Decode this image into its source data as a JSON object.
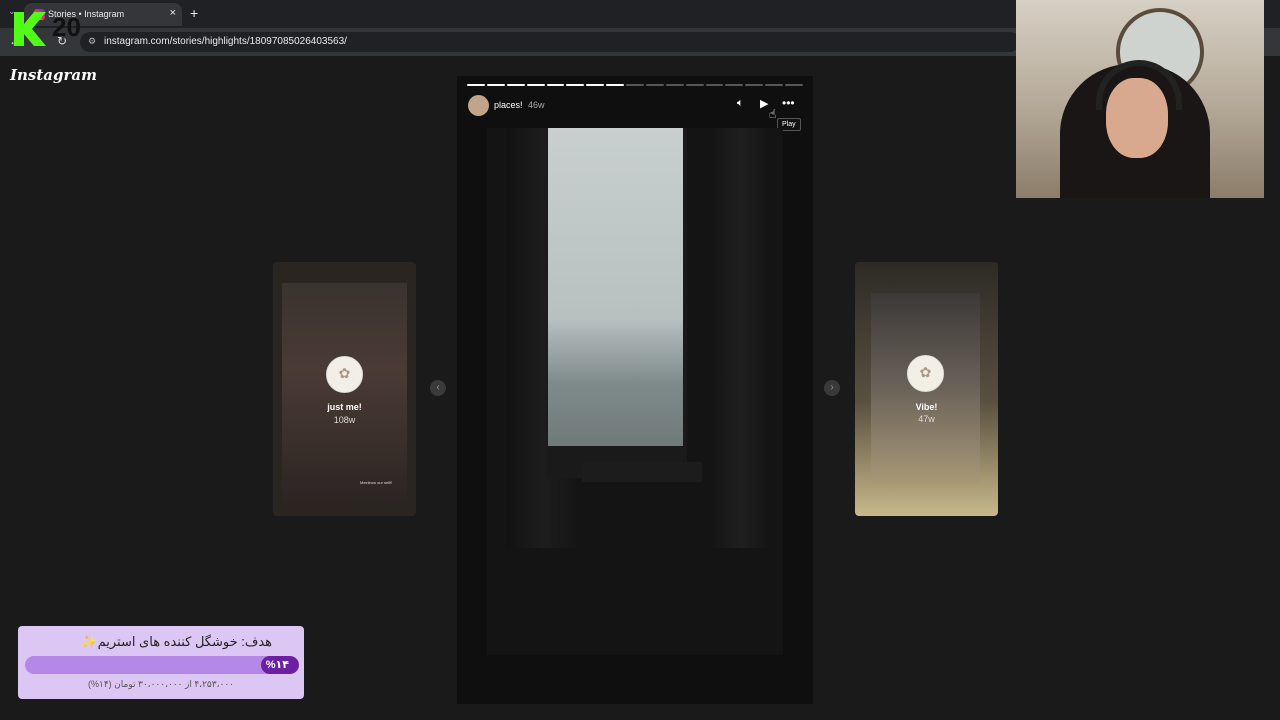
{
  "browser": {
    "tab_title": "Stories • Instagram",
    "tab_close": "×",
    "new_tab": "+",
    "url": "instagram.com/stories/highlights/18097085026403563/"
  },
  "overlay": {
    "logo_number": "20"
  },
  "instagram": {
    "logo": "Instagram"
  },
  "story": {
    "username": "places!",
    "time": "46w",
    "tooltip": "Play",
    "progress_total": 17,
    "progress_done": 8
  },
  "highlights": {
    "left": {
      "name": "just me!",
      "time": "108w",
      "caption": "Meeleow our selfi!"
    },
    "right": {
      "name": "Vibe!",
      "time": "47w"
    }
  },
  "goal": {
    "title": "هدف: خوشگل کننده های استریم✨",
    "percent_label": "%۱۴",
    "percent_value": 14,
    "subtitle": "۴،۲۵۳،۰۰۰ از ۳۰،۰۰۰،۰۰۰ تومان (۱۴%)"
  },
  "icons": {
    "mute": "speaker-icon",
    "play": "play-icon",
    "more": "more-icon"
  }
}
